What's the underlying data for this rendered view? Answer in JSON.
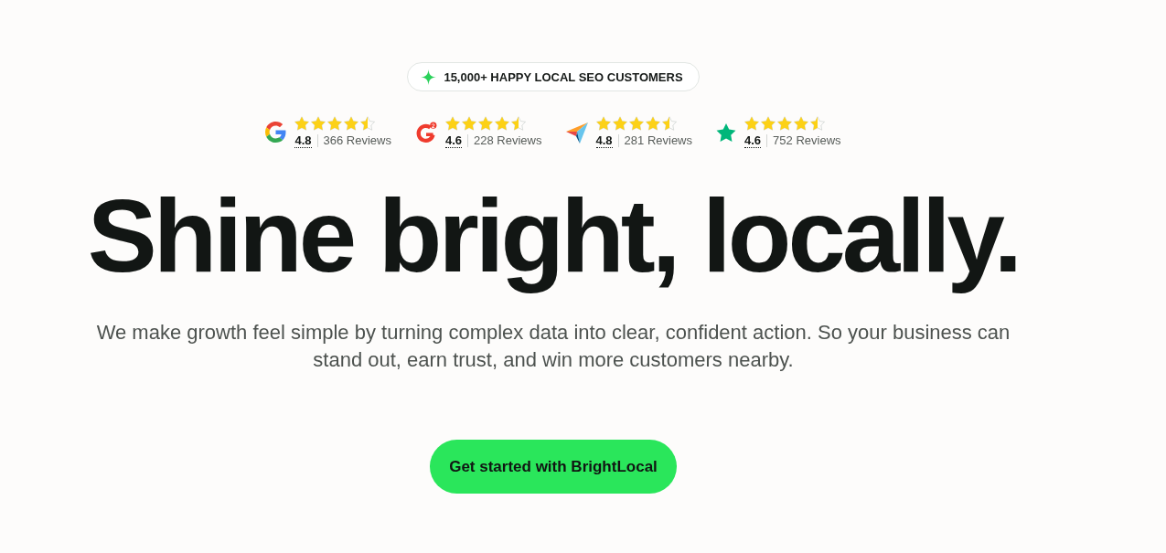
{
  "badge": {
    "text": "15,000+ HAPPY LOCAL SEO CUSTOMERS"
  },
  "ratings": [
    {
      "kind": "google",
      "stars": 4.5,
      "score": "4.8",
      "reviews": "366 Reviews"
    },
    {
      "kind": "g2",
      "stars": 4.5,
      "score": "4.6",
      "reviews": "228 Reviews"
    },
    {
      "kind": "capterra",
      "stars": 4.5,
      "score": "4.8",
      "reviews": "281 Reviews"
    },
    {
      "kind": "trustpilot",
      "stars": 4.5,
      "score": "4.6",
      "reviews": "752 Reviews"
    }
  ],
  "headline": "Shine bright, locally.",
  "description": "We make growth feel simple by turning complex data into clear, confident action. So your business can stand out, earn trust, and win more customers nearby.",
  "cta": {
    "label": "Get started with BrightLocal"
  }
}
